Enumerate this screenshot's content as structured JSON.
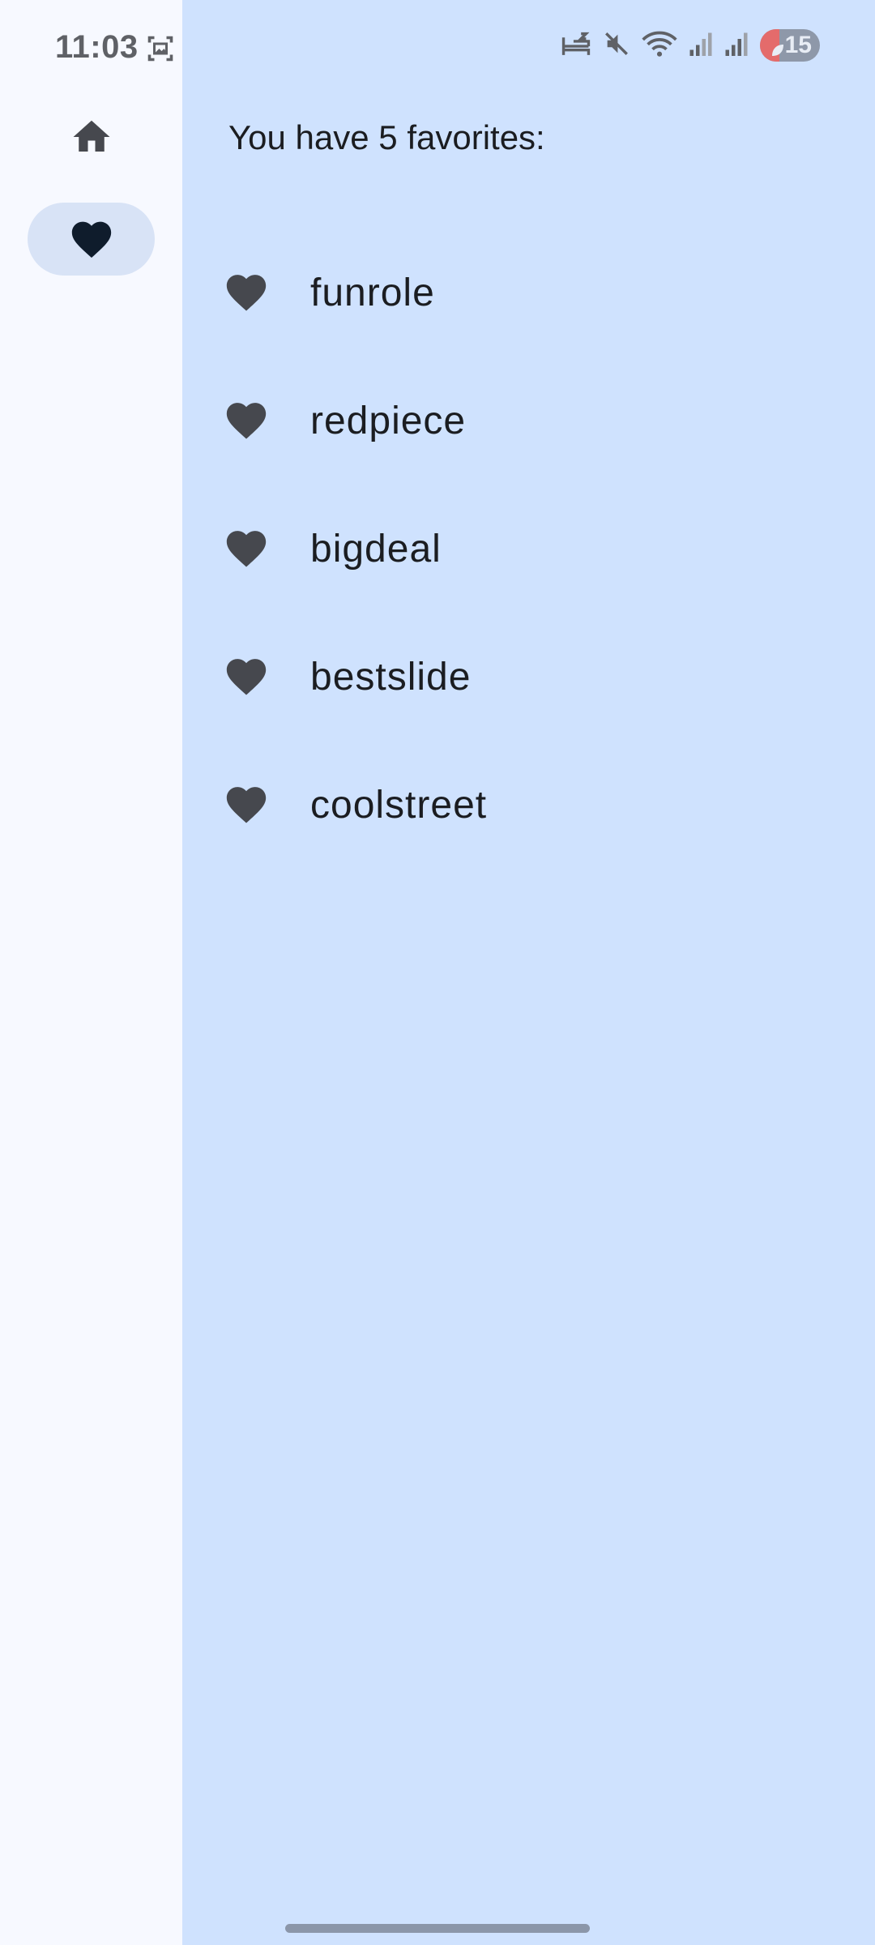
{
  "status_bar": {
    "time": "11:03",
    "battery_level": "15",
    "icons": [
      "screenshot-icon",
      "sleep-icon",
      "mute-icon",
      "wifi-icon",
      "signal-icon",
      "signal-icon",
      "battery-saver-icon"
    ]
  },
  "nav_rail": {
    "items": [
      {
        "name": "home",
        "icon": "home-icon",
        "selected": false
      },
      {
        "name": "favorites",
        "icon": "heart-icon",
        "selected": true
      }
    ]
  },
  "favorites": {
    "header": "You have 5 favorites:",
    "items": [
      {
        "label": "funrole"
      },
      {
        "label": "redpiece"
      },
      {
        "label": "bigdeal"
      },
      {
        "label": "bestslide"
      },
      {
        "label": "coolstreet"
      }
    ]
  },
  "colors": {
    "rail_bg": "#f7f9ff",
    "content_bg": "#cfe2fe",
    "selected_pill": "#d8e3f6",
    "icon": "#46484e",
    "text": "#1b1d21"
  }
}
